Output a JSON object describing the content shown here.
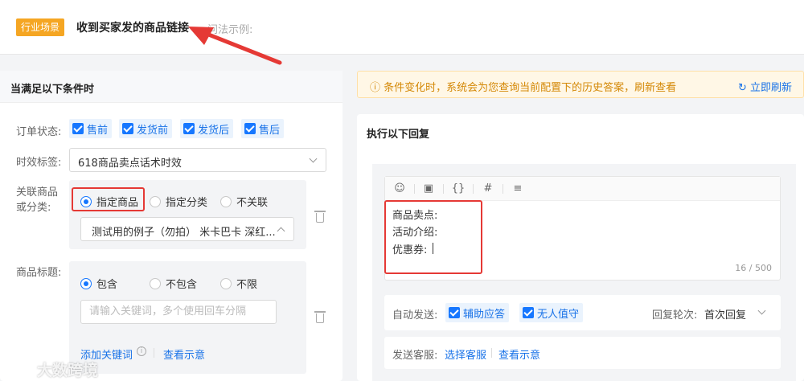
{
  "header": {
    "tag": "行业场景",
    "title": "收到买家发的商品链接",
    "subtitle": "问法示例:"
  },
  "left": {
    "title": "当满足以下条件时",
    "order_status": {
      "label": "订单状态:",
      "options": [
        "售前",
        "发货前",
        "发货后",
        "售后"
      ]
    },
    "time_tag": {
      "label": "时效标签:",
      "value": "618商品卖点话术时效"
    },
    "related": {
      "label_line1": "关联商品",
      "label_line2": "或分类:",
      "options": [
        "指定商品",
        "指定分类",
        "不关联"
      ],
      "selected": "指定商品",
      "product_value": "测试用的例子（勿拍） 米卡巴卡 深红..."
    },
    "product_title": {
      "label": "商品标题:",
      "options": [
        "包含",
        "不包含",
        "不限"
      ],
      "selected": "包含",
      "keyword_placeholder": "请输入关键词，多个使用回车分隔",
      "add_keyword": "添加关键词",
      "view_example": "查看示意"
    }
  },
  "notice": {
    "text": "条件变化时，系统会为您查询当前配置下的历史答案，刷新查看",
    "action": "立即刷新"
  },
  "right": {
    "title": "执行以下回复",
    "editor": {
      "lines": [
        "商品卖点:",
        "活动介绍:",
        "优惠券:"
      ],
      "counter": "16 / 500"
    },
    "auto_send": {
      "label": "自动发送:",
      "options": [
        "辅助应答",
        "无人值守"
      ],
      "rounds_label": "回复轮次:",
      "rounds_value": "首次回复"
    },
    "send_service": {
      "label": "发送客服:",
      "select": "选择客服",
      "view": "查看示意"
    }
  },
  "watermark": "大数跨境",
  "colors": {
    "accent": "#1677ff",
    "tag": "#f5a623",
    "highlight": "#e53935",
    "notice_bg": "#fff7e6"
  }
}
